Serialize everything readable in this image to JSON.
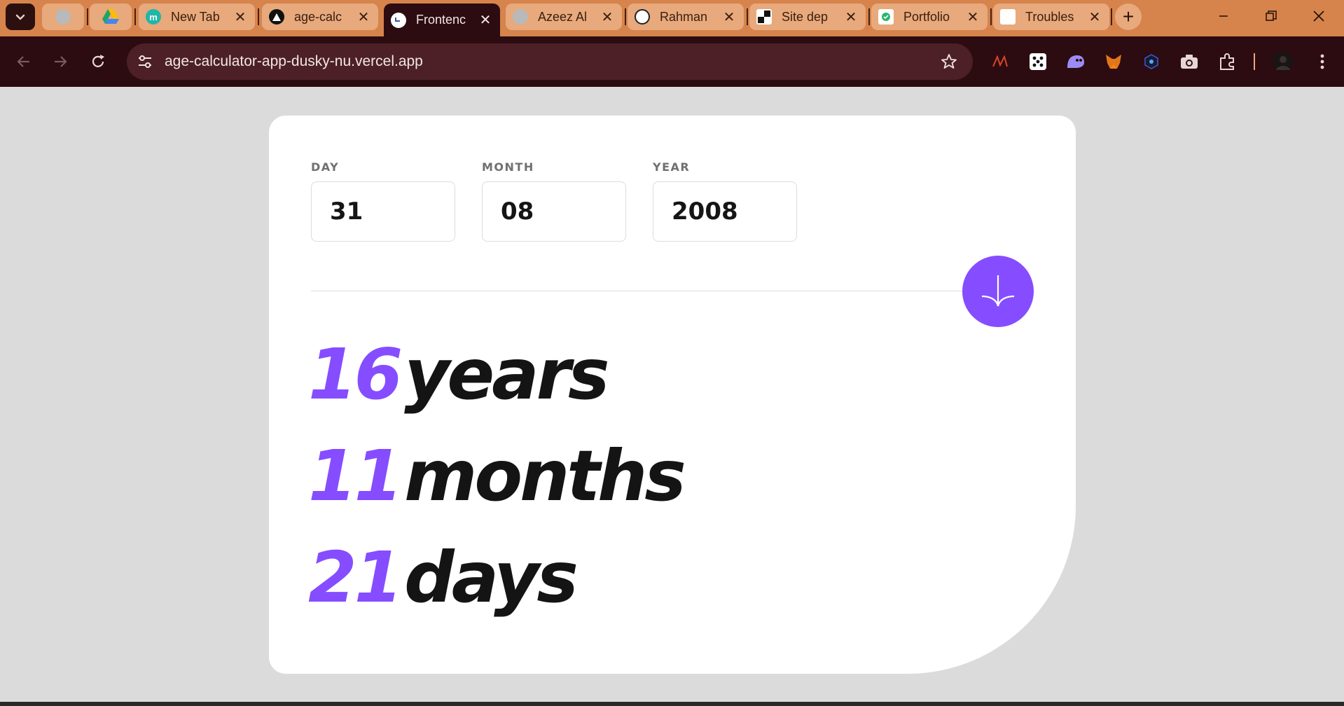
{
  "browser": {
    "tabs": [
      {
        "title": "",
        "favicon": "globe-icon"
      },
      {
        "title": "",
        "favicon": "google-drive-icon"
      },
      {
        "title": "New Tab",
        "favicon": "m-icon"
      },
      {
        "title": "age-calc",
        "favicon": "vercel-icon"
      },
      {
        "title": "Frontenc",
        "favicon": "frontend-mentor-icon"
      },
      {
        "title": "Azeez Al",
        "favicon": "globe-icon"
      },
      {
        "title": "Rahman",
        "favicon": "github-icon"
      },
      {
        "title": "Site dep",
        "favicon": "netlify-icon"
      },
      {
        "title": "Portfolio",
        "favicon": "portfolio-icon"
      },
      {
        "title": "Troubles",
        "favicon": "pencil-icon"
      }
    ],
    "active_tab_index": 4,
    "url": "age-calculator-app-dusky-nu.vercel.app"
  },
  "calculator": {
    "day": {
      "label": "DAY",
      "value": "31"
    },
    "month": {
      "label": "MONTH",
      "value": "08"
    },
    "year": {
      "label": "YEAR",
      "value": "2008"
    },
    "results": {
      "years": {
        "value": "16",
        "unit": "years"
      },
      "months": {
        "value": "11",
        "unit": "months"
      },
      "days": {
        "value": "21",
        "unit": "days"
      }
    }
  },
  "colors": {
    "accent": "#854dff",
    "tabstrip": "#d6844c",
    "toolbar": "#2c0c10",
    "page_bg": "#dbdbdb"
  }
}
